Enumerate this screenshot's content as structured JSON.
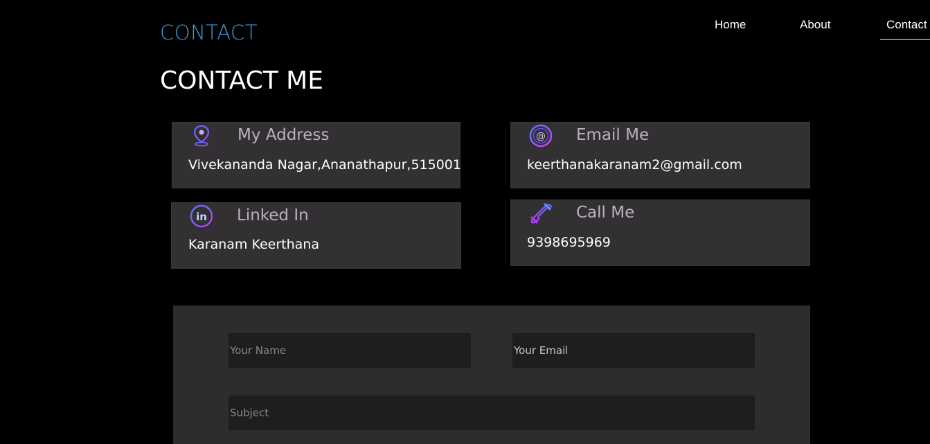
{
  "header": {
    "brand": "CONTACT",
    "nav": [
      {
        "label": "Home"
      },
      {
        "label": "About"
      },
      {
        "label": "Contact"
      }
    ],
    "accent_color": "#3a9ad9"
  },
  "main": {
    "title": "CONTACT ME",
    "cards": [
      {
        "icon": "location-pin-icon",
        "label": "My Address",
        "value": "Vivekananda Nagar,Ananathapur,515001"
      },
      {
        "icon": "at-sign-icon",
        "label": "Email Me",
        "value": "keerthanakaranam2@gmail.com"
      },
      {
        "icon": "linkedin-icon",
        "label": "Linked In",
        "value": "Karanam Keerthana"
      },
      {
        "icon": "phone-icon",
        "label": "Call Me",
        "value": "9398695969"
      }
    ],
    "form": {
      "name_placeholder": "Your Name",
      "email_placeholder": "Your Email",
      "subject_placeholder": "Subject"
    }
  }
}
